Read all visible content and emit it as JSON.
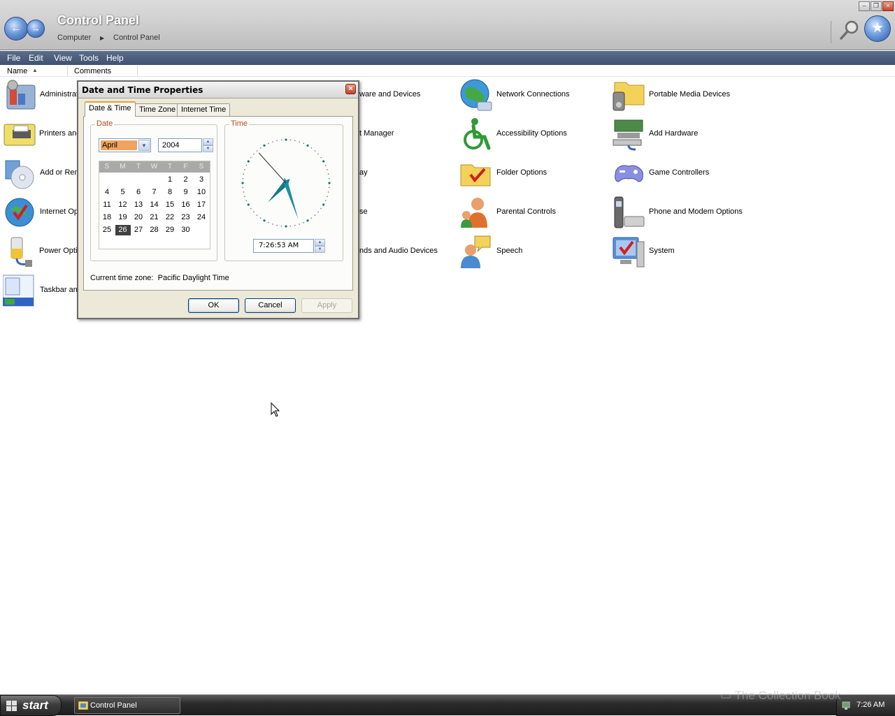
{
  "window": {
    "title": "Control Panel",
    "breadcrumb": [
      "Computer",
      "Control Panel"
    ]
  },
  "menu": [
    "File",
    "Edit",
    "View",
    "Tools",
    "Help"
  ],
  "columns": {
    "name": "Name",
    "comments": "Comments"
  },
  "items": {
    "c0": [
      "Administrat",
      "Printers and",
      "Add or Rem",
      "Internet Op",
      "Power Opti",
      "Taskbar an"
    ],
    "c1": [
      "ware and Devices",
      "t Manager",
      "ay",
      "se",
      "nds and Audio Devices"
    ],
    "c2": [
      "Network Connections",
      "Accessibility Options",
      "Folder Options",
      "Parental Controls",
      "Speech"
    ],
    "c3": [
      "Portable Media Devices",
      "Add Hardware",
      "Game Controllers",
      "Phone and Modem Options",
      "System"
    ]
  },
  "dialog": {
    "title": "Date and Time Properties",
    "tabs": [
      "Date & Time",
      "Time Zone",
      "Internet Time"
    ],
    "date_group": "Date",
    "time_group": "Time",
    "month": "April",
    "year": "2004",
    "dow": [
      "S",
      "M",
      "T",
      "W",
      "T",
      "F",
      "S"
    ],
    "first_weekday": 4,
    "days_in_month": 30,
    "selected_day": 26,
    "time": "7:26:53 AM",
    "clock": {
      "hours": 7,
      "minutes": 26,
      "seconds": 53
    },
    "time_zone_label": "Current time zone:",
    "time_zone": "Pacific Daylight Time",
    "buttons": {
      "ok": "OK",
      "cancel": "Cancel",
      "apply": "Apply"
    }
  },
  "taskbar": {
    "start": "start",
    "task": "Control Panel",
    "clock": "7:26 AM",
    "watermark": "The Collection Book"
  },
  "colors": {
    "accent": "#e6a334",
    "selection": "#f0a35f",
    "menu_bar": "#4a5d7c"
  }
}
